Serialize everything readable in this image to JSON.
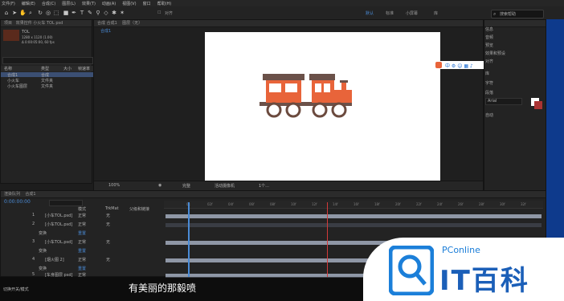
{
  "menu": [
    "文件(F)",
    "编辑(E)",
    "合成(C)",
    "图层(L)",
    "效果(T)",
    "动画(A)",
    "视图(V)",
    "窗口",
    "帮助(H)"
  ],
  "toolbar": {
    "snap_label": "对齐",
    "workspaces": [
      "默认",
      "标准",
      "小屏幕",
      "库"
    ],
    "active_workspace": "默认",
    "search_placeholder": "搜索帮助"
  },
  "project": {
    "tab": "项目",
    "effects_tab": "效果控件 小火车 TOL psd",
    "item_name": "TOL",
    "item_info": [
      "1280 x 1120 (1.00)",
      "Δ 0:00:05:00, 60 fps"
    ],
    "col_name": "名称",
    "col_type": "类型",
    "col_size": "大小",
    "col_rate": "帧速率",
    "items": [
      {
        "name": "合成1",
        "type": "合成"
      },
      {
        "name": "小火车",
        "type": "文件夹"
      },
      {
        "name": "小火车图层",
        "type": "文件夹"
      }
    ]
  },
  "composition": {
    "tab": "合成 合成1",
    "layer_tab": "图层（无）",
    "crumb": "合成1",
    "zoom": "100%",
    "quality": "完整",
    "camera": "活动摄像机",
    "views": "1个..."
  },
  "right_panel": {
    "items": [
      "信息",
      "音频",
      "预览",
      "效果和预设",
      "对齐",
      "库",
      "字符",
      "段落",
      "跟踪器",
      "画笔"
    ],
    "font": "Arial",
    "leading": "自动"
  },
  "timeline": {
    "tab": "渲染队列",
    "comp_tab": "合成1",
    "timecode": "0:00:00:00",
    "col_mode": "模式",
    "col_trkmat": "TrkMat",
    "col_parent": "父级和链接",
    "rows": [
      {
        "num": "1",
        "name": "[小车TOL.psd]",
        "mode": "正常",
        "parent": "无"
      },
      {
        "num": "",
        "name": "变换",
        "mode": "",
        "parent": "重置"
      },
      {
        "num": "2",
        "name": "[小车TOL.psd]",
        "mode": "正常",
        "parent": "无"
      },
      {
        "num": "",
        "name": "变换",
        "mode": "",
        "parent": "重置"
      },
      {
        "num": "3",
        "name": "[小车TOL.psd]",
        "mode": "正常",
        "parent": "无"
      },
      {
        "num": "",
        "name": "变换",
        "mode": "",
        "parent": "重置"
      },
      {
        "num": "4",
        "name": "[烟火图 2]",
        "mode": "正常",
        "parent": "无"
      },
      {
        "num": "",
        "name": "变换",
        "mode": "",
        "parent": "重置"
      },
      {
        "num": "5",
        "name": "[车身图层 psd]",
        "mode": "正常",
        "parent": "无"
      }
    ],
    "ruler": [
      "0s",
      "02f",
      "04f",
      "06f",
      "08f",
      "10f",
      "12f",
      "14f",
      "16f",
      "18f",
      "20f",
      "22f",
      "24f",
      "26f",
      "28f",
      "30f",
      "32f",
      "34f"
    ],
    "footer": "切换开关/模式"
  },
  "caption": "有美丽的那毅喷",
  "logo": {
    "brand": "PConline",
    "big": "IT百科"
  },
  "colors": {
    "train_body": "#e8643a",
    "train_roof": "#6b5149",
    "wheel": "#6b4a3e",
    "accent": "#4a8bd6"
  }
}
